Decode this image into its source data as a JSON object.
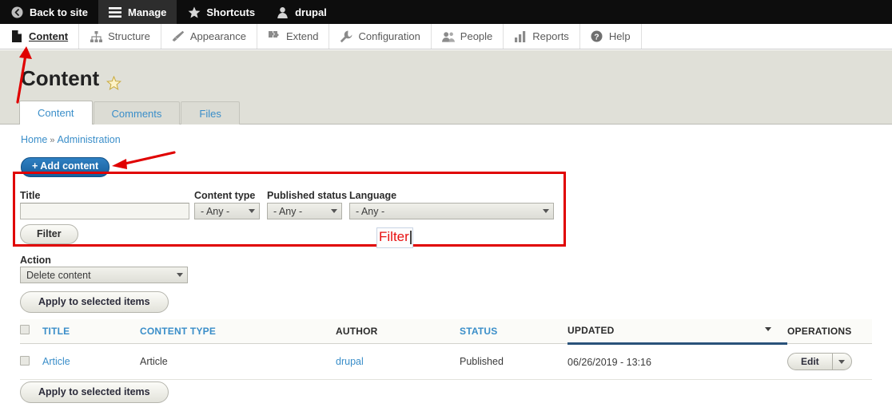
{
  "toolbar": {
    "items": [
      {
        "label": "Back to site",
        "icon": "back-arrow-icon",
        "active": false
      },
      {
        "label": "Manage",
        "icon": "hamburger-icon",
        "active": true
      },
      {
        "label": "Shortcuts",
        "icon": "star-icon",
        "active": false
      },
      {
        "label": "drupal",
        "icon": "user-icon",
        "active": false
      }
    ]
  },
  "admin_menu": {
    "items": [
      {
        "label": "Content",
        "icon": "page-icon",
        "active": true
      },
      {
        "label": "Structure",
        "icon": "sitemap-icon",
        "active": false
      },
      {
        "label": "Appearance",
        "icon": "brush-icon",
        "active": false
      },
      {
        "label": "Extend",
        "icon": "puzzle-icon",
        "active": false
      },
      {
        "label": "Configuration",
        "icon": "wrench-icon",
        "active": false
      },
      {
        "label": "People",
        "icon": "people-icon",
        "active": false
      },
      {
        "label": "Reports",
        "icon": "bar-chart-icon",
        "active": false
      },
      {
        "label": "Help",
        "icon": "question-mark-icon",
        "active": false
      }
    ]
  },
  "page": {
    "title": "Content",
    "star_icon": "favorite-star-icon"
  },
  "tabs": [
    {
      "label": "Content",
      "active": true
    },
    {
      "label": "Comments",
      "active": false
    },
    {
      "label": "Files",
      "active": false
    }
  ],
  "breadcrumb": {
    "home": "Home",
    "separator": "»",
    "current": "Administration"
  },
  "add_content": {
    "label": "+ Add content"
  },
  "filter": {
    "title_label": "Title",
    "title_value": "",
    "content_type_label": "Content type",
    "content_type_value": "- Any -",
    "published_status_label": "Published status",
    "published_status_value": "- Any -",
    "language_label": "Language",
    "language_value": "- Any -",
    "submit_label": "Filter"
  },
  "annotation": {
    "text": "Filter",
    "box_color": "#e00000",
    "text_color": "#e81010"
  },
  "action": {
    "label": "Action",
    "value": "Delete content",
    "apply_label": "Apply to selected items",
    "apply_label_bottom": "Apply to selected items"
  },
  "table": {
    "headers": [
      {
        "label": "",
        "name": "select-all",
        "sortable": false
      },
      {
        "label": "TITLE",
        "name": "title",
        "sortable": true
      },
      {
        "label": "CONTENT TYPE",
        "name": "content-type",
        "sortable": true
      },
      {
        "label": "AUTHOR",
        "name": "author",
        "sortable": false
      },
      {
        "label": "STATUS",
        "name": "status",
        "sortable": true
      },
      {
        "label": "UPDATED",
        "name": "updated",
        "sortable": true,
        "sorted": true,
        "sort_dir": "desc"
      },
      {
        "label": "OPERATIONS",
        "name": "operations",
        "sortable": false
      }
    ],
    "rows": [
      {
        "title": "Article",
        "content_type": "Article",
        "author": "drupal",
        "status": "Published",
        "updated": "06/26/2019 - 13:16",
        "operation": "Edit"
      }
    ]
  }
}
